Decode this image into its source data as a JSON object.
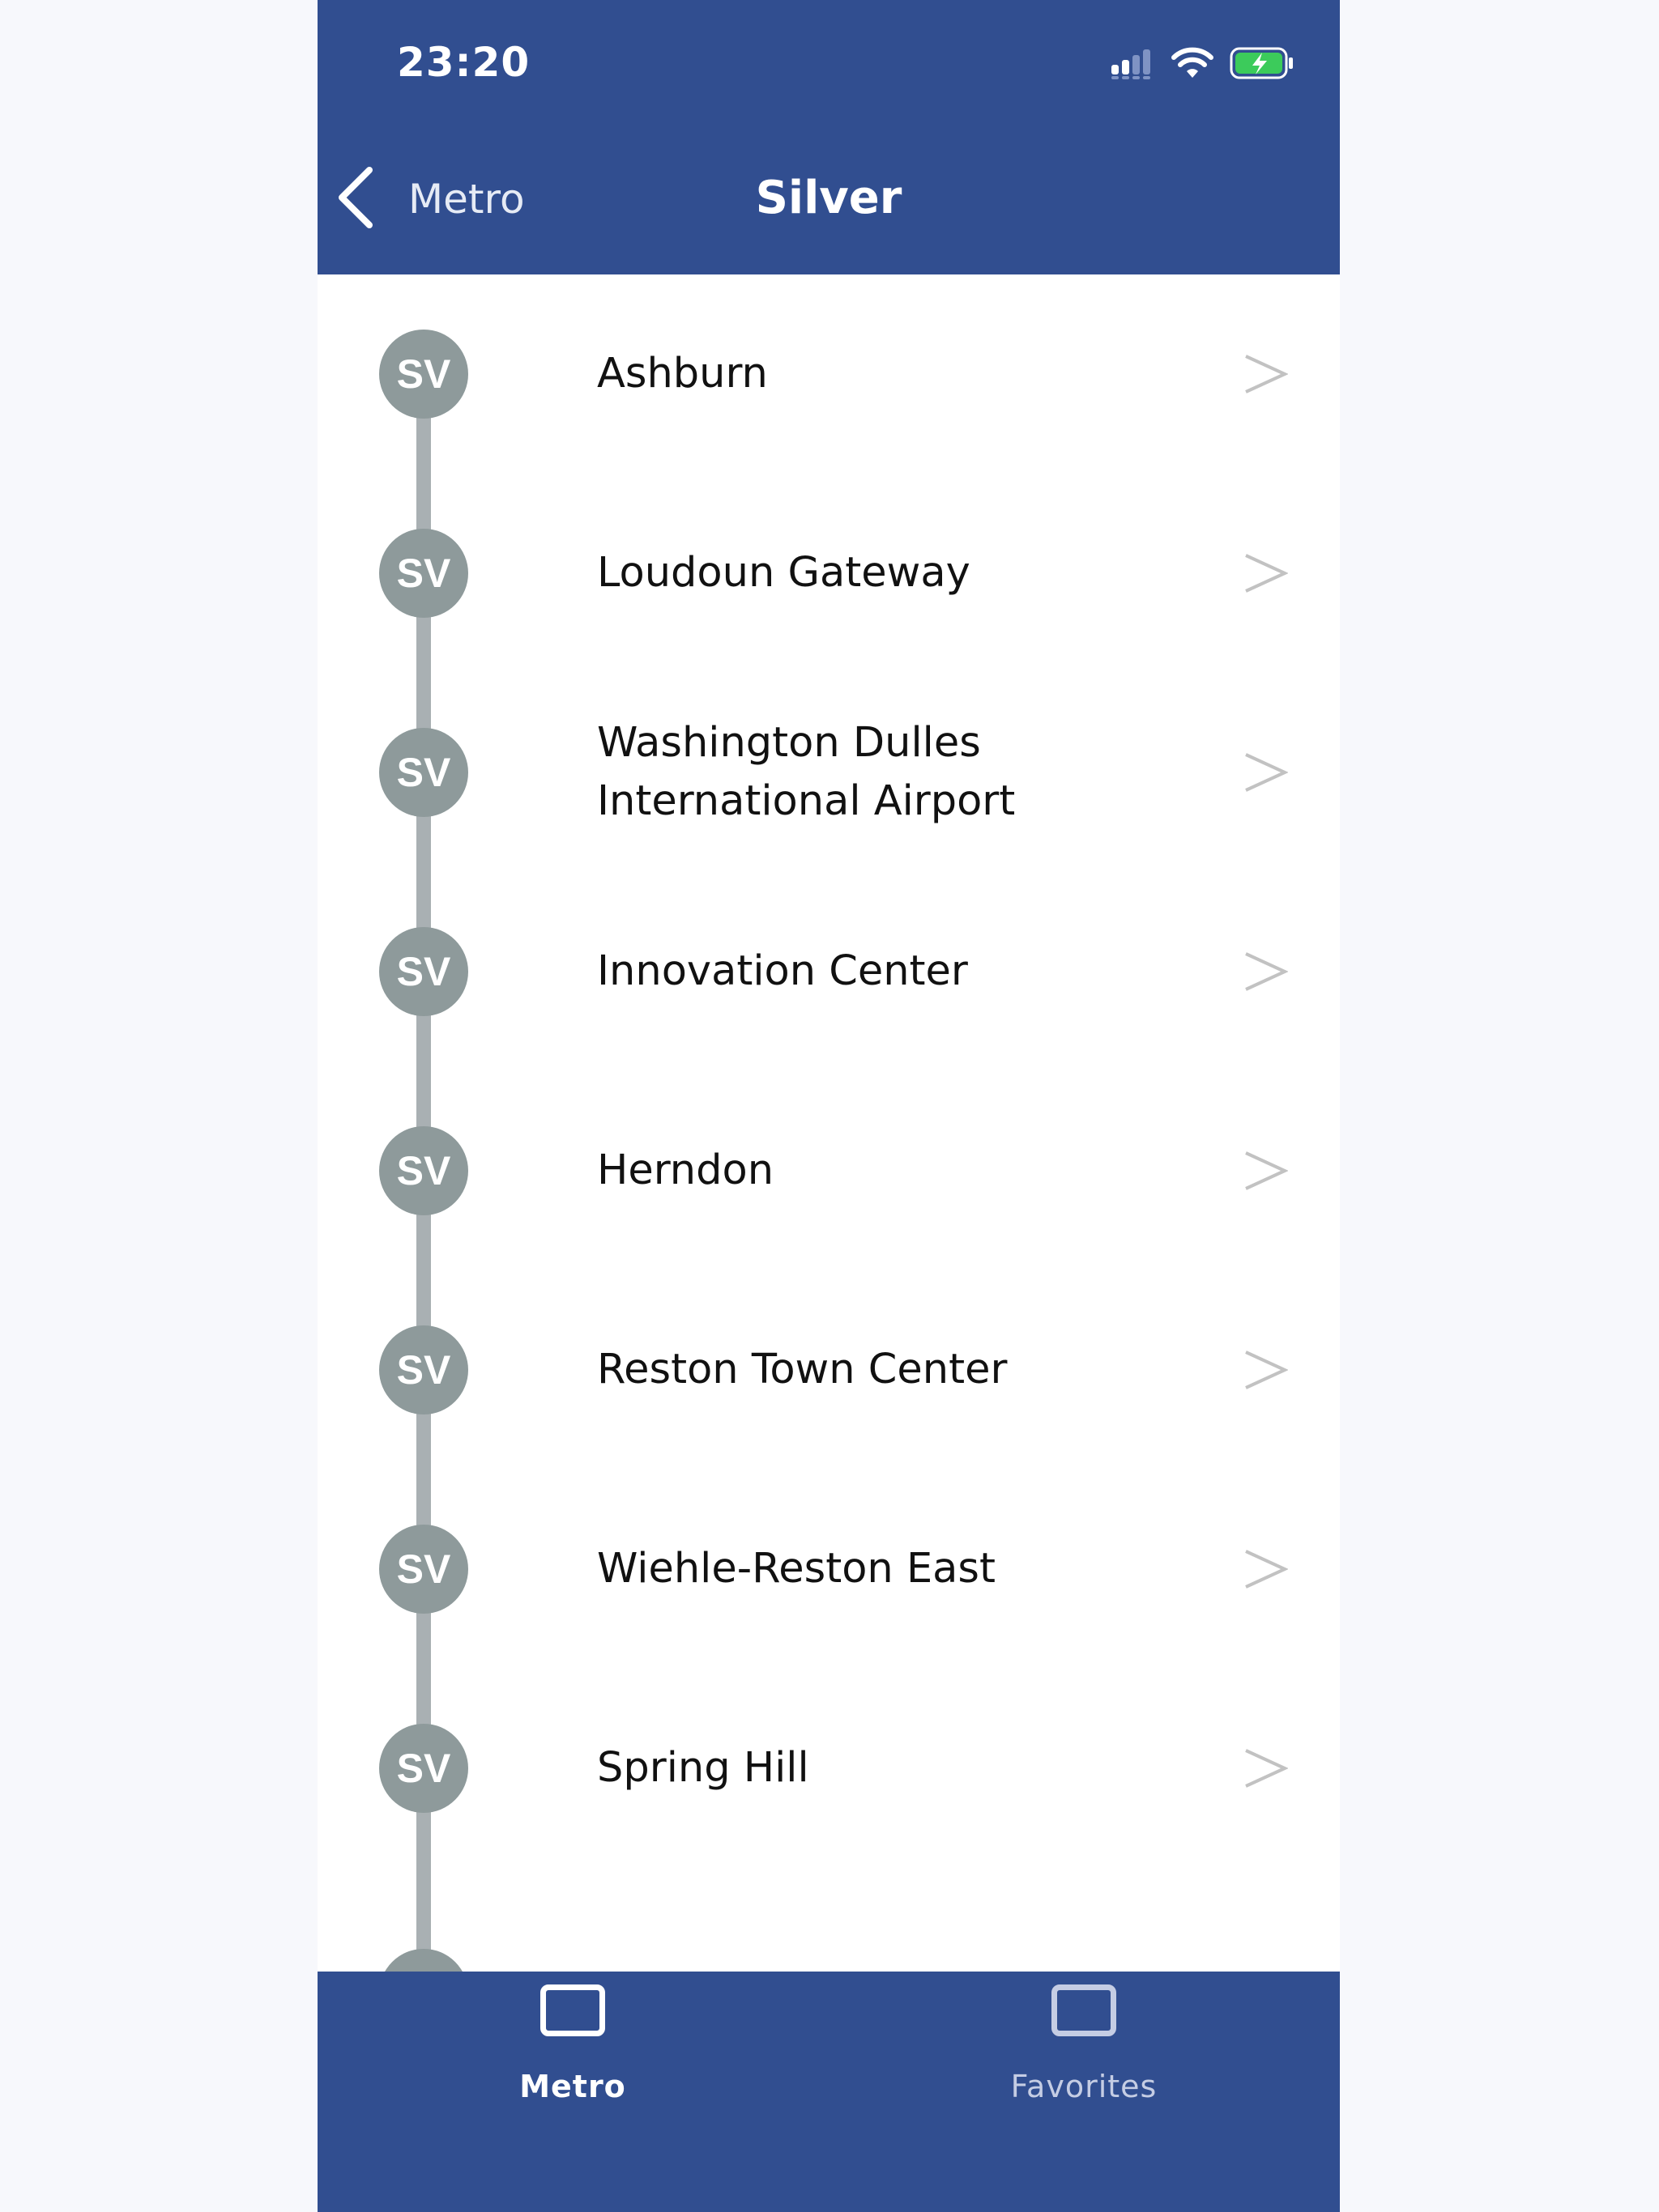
{
  "status_bar": {
    "time": "23:20",
    "icons": [
      "signal-icon",
      "wifi-icon",
      "battery-charging-icon"
    ]
  },
  "nav": {
    "back_label": "Metro",
    "title": "Silver"
  },
  "line": {
    "code": "SV",
    "color": "#8e9a9b",
    "track_color": "#a9b0b3"
  },
  "stations": [
    {
      "code": "SV",
      "name": "Ashburn"
    },
    {
      "code": "SV",
      "name": "Loudoun Gateway"
    },
    {
      "code": "SV",
      "name": "Washington Dulles International Airport"
    },
    {
      "code": "SV",
      "name": "Innovation Center"
    },
    {
      "code": "SV",
      "name": "Herndon"
    },
    {
      "code": "SV",
      "name": "Reston Town Center"
    },
    {
      "code": "SV",
      "name": "Wiehle-Reston East"
    },
    {
      "code": "SV",
      "name": "Spring Hill"
    }
  ],
  "tabs": [
    {
      "label": "Metro",
      "selected": true
    },
    {
      "label": "Favorites",
      "selected": false
    }
  ],
  "colors": {
    "brand_blue": "#314e90",
    "tab_active": "#ffffff",
    "tab_inactive": "#c5cde4"
  }
}
